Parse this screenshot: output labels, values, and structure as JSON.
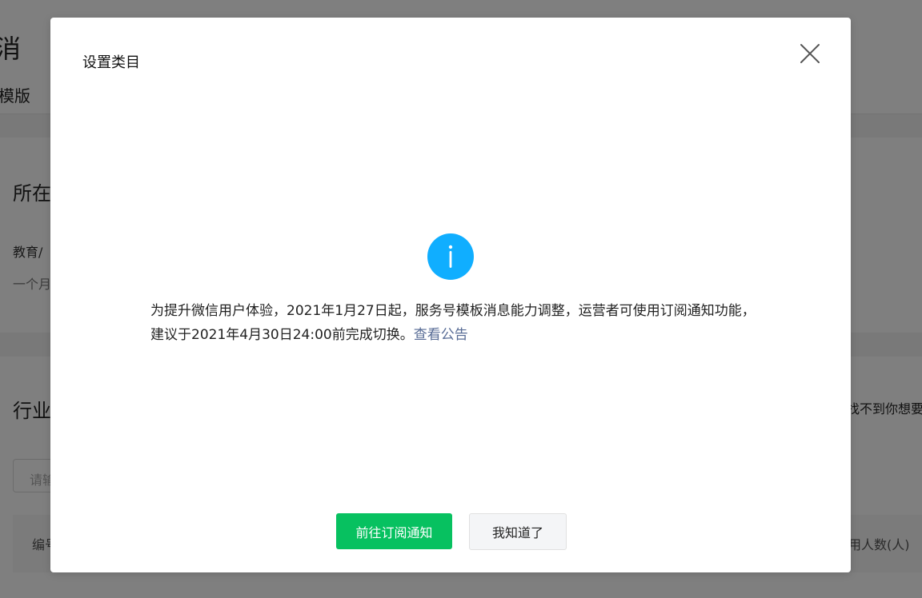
{
  "background": {
    "page_title_partial": "版消",
    "tab_partial": "的模版",
    "section1": {
      "title_partial": "所在",
      "label_partial": "教育/",
      "sub_partial": "一个月"
    },
    "section2": {
      "title_partial": "行业",
      "right_link_partial": "找不到你想要",
      "search_placeholder_partial": "请输",
      "table_col_first_partial": "编号",
      "table_col_last_partial": "用人数(人)"
    }
  },
  "modal": {
    "title": "设置类目",
    "message": "为提升微信用户体验，2021年1月27日起，服务号模板消息能力调整，运营者可使用订阅通知功能，建议于2021年4月30日24:00前完成切换。",
    "link_label": "查看公告",
    "primary_button": "前往订阅通知",
    "secondary_button": "我知道了",
    "icons": {
      "close": "close-icon",
      "info": "info-icon"
    },
    "colors": {
      "primary": "#07c160",
      "info": "#10aeff",
      "link": "#576b95"
    }
  }
}
